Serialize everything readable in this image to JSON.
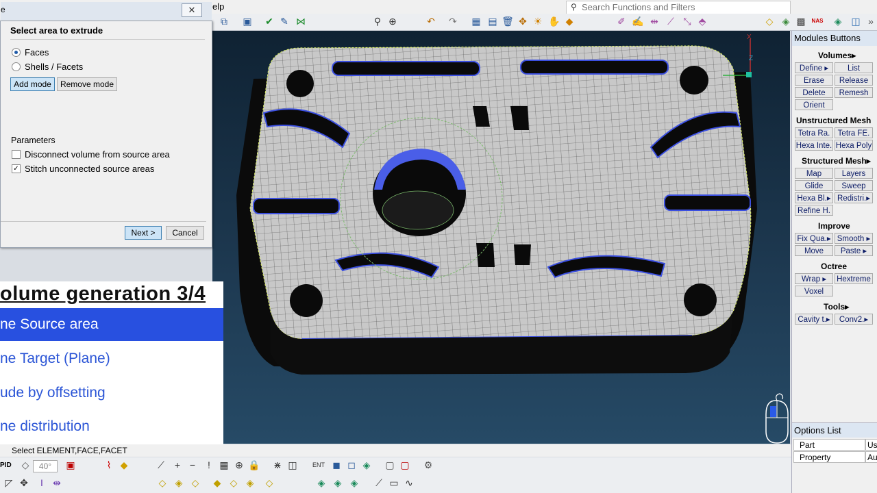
{
  "menubar": {
    "help_label": "elp"
  },
  "search": {
    "placeholder": "Search Functions and Filters"
  },
  "dialog": {
    "title_char": "e",
    "close_symbol": "✕",
    "heading": "Select area to extrude",
    "radio_faces": "Faces",
    "radio_shells": "Shells / Facets",
    "add_mode": "Add mode",
    "remove_mode": "Remove mode",
    "parameters_label": "Parameters",
    "check_disconnect": "Disconnect volume from source area",
    "check_stitch": "Stitch unconnected source areas",
    "next": "Next >",
    "cancel": "Cancel"
  },
  "tutorial": {
    "title": "olume generation 3/4",
    "steps": [
      "ne Source area",
      "ne Target (Plane)",
      "ude by offsetting",
      "ne distribution"
    ]
  },
  "right_panel": {
    "header": "Modules Buttons",
    "sections": {
      "volumes": "Volumes▸",
      "unstructured": "Unstructured Mesh",
      "structured": "Structured Mesh▸",
      "improve": "Improve",
      "octree": "Octree",
      "tools": "Tools▸"
    },
    "volumes_buttons": [
      "Define ▸",
      "List",
      "Erase",
      "Release",
      "Delete",
      "Remesh",
      "Orient"
    ],
    "unstructured_buttons": [
      "Tetra Ra.",
      "Tetra FE.",
      "Hexa Inte.",
      "Hexa Poly"
    ],
    "structured_buttons": [
      "Map",
      "Layers",
      "Glide",
      "Sweep",
      "Hexa Bl.▸",
      "Redistri.▸",
      "Refine H."
    ],
    "improve_buttons": [
      "Fix Qua.▸",
      "Smooth ▸",
      "Move",
      "Paste ▸"
    ],
    "octree_buttons": [
      "Wrap ▸",
      "Hextreme",
      "Voxel"
    ],
    "tools_buttons": [
      "Cavity t.▸",
      "Conv2.▸"
    ],
    "options_header": "Options List",
    "options": [
      {
        "label": "Part",
        "value": "Us"
      },
      {
        "label": "Property",
        "value": "Au"
      }
    ]
  },
  "status": {
    "text": "Select ELEMENT,FACE,FACET"
  },
  "bottom_toolbar": {
    "angle_value": "40°",
    "left_label": "PID"
  },
  "axis": {
    "x": "X",
    "z": "Z"
  },
  "colors": {
    "accent": "#2850e0",
    "mesh_fill": "#c8c8c8",
    "viewport_top": "#0f2233",
    "highlight": "#3b4fe0"
  }
}
